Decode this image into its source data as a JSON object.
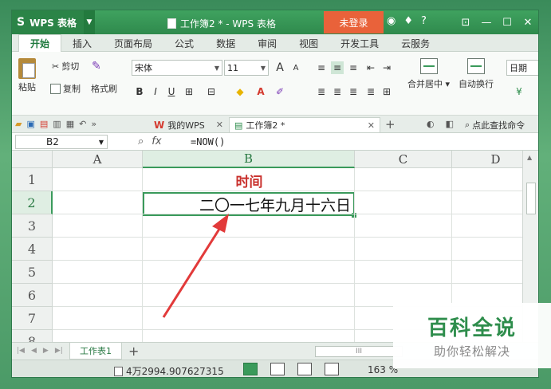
{
  "app": {
    "menu_label": "WPS 表格",
    "logo_glyph": "S",
    "document_title": "工作簿2 * - WPS 表格",
    "login_label": "未登录",
    "help_label": "?"
  },
  "ribbon": {
    "tabs": [
      "开始",
      "插入",
      "页面布局",
      "公式",
      "数据",
      "审阅",
      "视图",
      "开发工具",
      "云服务"
    ],
    "active_tab": "开始"
  },
  "toolbar": {
    "paste": "粘贴",
    "cut": "剪切",
    "copy": "复制",
    "format_painter": "格式刷",
    "font_name": "宋体",
    "font_size": "11",
    "bold": "B",
    "italic": "I",
    "underline": "U",
    "merge_center": "合并居中",
    "wrap_text": "自动换行",
    "number_format": "日期",
    "font_grow": "A",
    "font_shrink": "A"
  },
  "docstrip": {
    "my_wps": "我的WPS",
    "workbook_tab": "工作簿2 *",
    "search_cmd": "点此查找命令"
  },
  "formula_bar": {
    "name_box": "B2",
    "fx": "fx",
    "formula": "=NOW()"
  },
  "grid": {
    "columns": [
      "A",
      "B",
      "C",
      "D"
    ],
    "rows": [
      "1",
      "2",
      "3",
      "4",
      "5",
      "6",
      "7",
      "8"
    ],
    "selected_column": "B",
    "selected_row": "2",
    "cell_B1": "时间",
    "cell_B2": "二〇一七年九月十六日"
  },
  "sheets": {
    "tabs": [
      "工作表1"
    ],
    "add": "+",
    "hscroll_mark": "III"
  },
  "status": {
    "sum": "4万2994.907627315",
    "zoom": "163 %"
  },
  "watermark": {
    "title": "百科全说",
    "subtitle": "助你轻松解决"
  },
  "colors": {
    "accent": "#3a9a5b",
    "title_text": "#c9302c",
    "login": "#e9623a",
    "arrow": "#e23a3a"
  }
}
